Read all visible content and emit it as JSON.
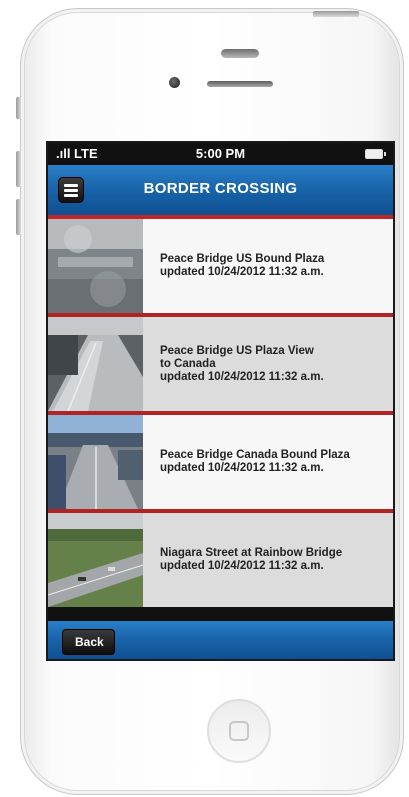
{
  "status_bar": {
    "signal": ".ıll LTE",
    "time": "5:00 PM"
  },
  "nav": {
    "title": "BORDER CROSSING"
  },
  "cameras": [
    {
      "line1": "Peace Bridge US Bound Plaza",
      "line2": "updated 10/24/2012 11:32 a.m.",
      "line3": ""
    },
    {
      "line1": "Peace Bridge US Plaza View",
      "line2": "to Canada",
      "line3": "updated 10/24/2012 11:32 a.m."
    },
    {
      "line1": "Peace Bridge Canada Bound Plaza",
      "line2": "updated 10/24/2012 11:32 a.m.",
      "line3": ""
    },
    {
      "line1": "Niagara Street at Rainbow Bridge",
      "line2": "updated 10/24/2012 11:32 a.m.",
      "line3": ""
    }
  ],
  "bottom_bar": {
    "back_label": "Back"
  },
  "colors": {
    "nav_blue": "#1a66ad",
    "divider_red": "#c12626"
  }
}
